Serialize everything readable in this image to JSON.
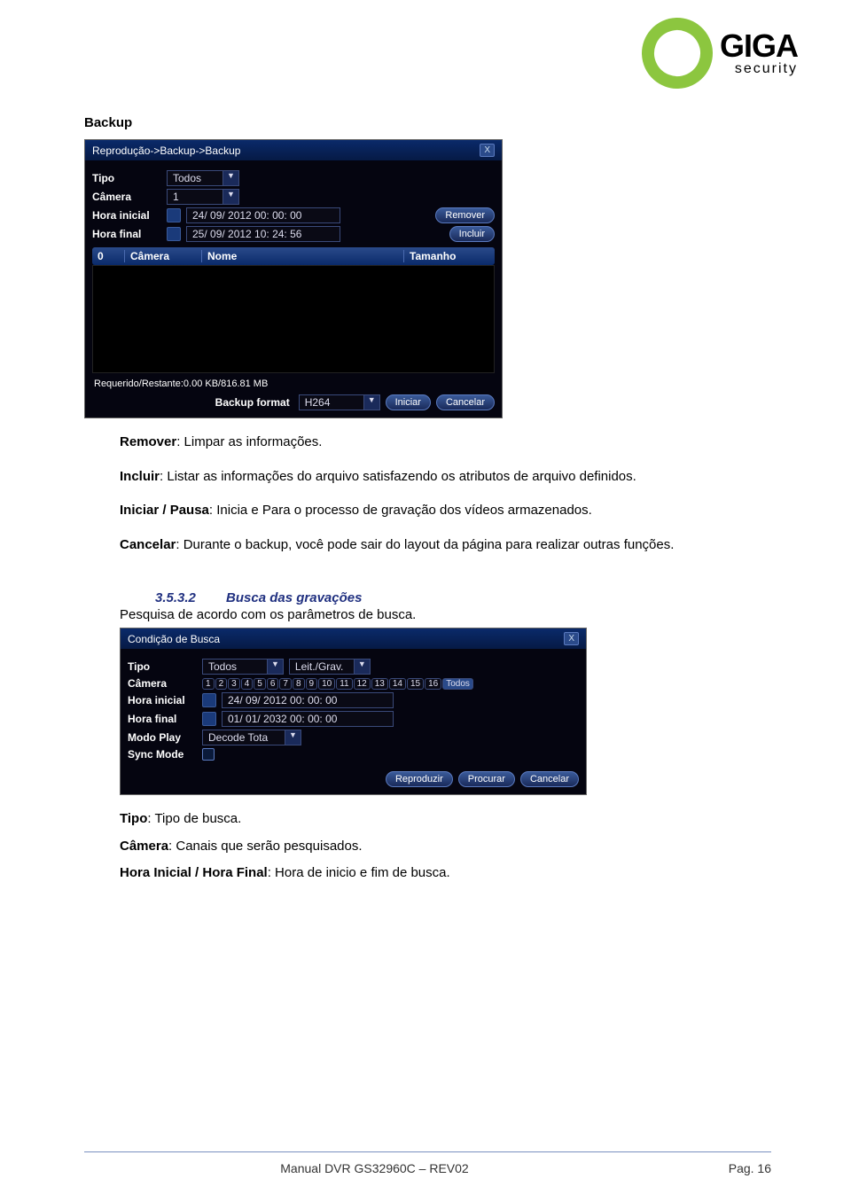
{
  "logo": {
    "brand": "GIGA",
    "sub": "security"
  },
  "section1": {
    "title": "Backup"
  },
  "backup_dialog": {
    "title": "Reprodução->Backup->Backup",
    "labels": {
      "tipo": "Tipo",
      "camera": "Câmera",
      "hora_inicial": "Hora inicial",
      "hora_final": "Hora final"
    },
    "values": {
      "tipo": "Todos",
      "camera": "1",
      "hora_inicial": "24/ 09/ 2012  00: 00: 00",
      "hora_final": "25/ 09/ 2012  10: 24: 56"
    },
    "buttons": {
      "remover": "Remover",
      "incluir": "Incluir"
    },
    "table": {
      "col0": "0",
      "col1": "Câmera",
      "col2": "Nome",
      "col3": "Tamanho"
    },
    "status": "Requerido/Restante:0.00 KB/816.81 MB",
    "footer": {
      "label": "Backup format",
      "format": "H264",
      "iniciar": "Iniciar",
      "cancelar": "Cancelar"
    }
  },
  "desc1": {
    "remover_b": "Remover",
    "remover_t": ": Limpar as informações.",
    "incluir_b": "Incluir",
    "incluir_t": ": Listar as informações do arquivo satisfazendo os atributos de arquivo definidos.",
    "iniciar_b": "Iniciar / Pausa",
    "iniciar_t": ": Inicia e Para o processo de gravação dos vídeos armazenados.",
    "cancelar_b": "Cancelar",
    "cancelar_t": ": Durante o backup, você pode sair do layout da página para realizar outras funções."
  },
  "section2": {
    "num": "3.5.3.2",
    "name": "Busca das gravações",
    "desc": "Pesquisa de acordo com os parâmetros de busca."
  },
  "busca_dialog": {
    "title": "Condição de Busca",
    "labels": {
      "tipo": "Tipo",
      "camera": "Câmera",
      "hora_inicial": "Hora inicial",
      "hora_final": "Hora final",
      "modo_play": "Modo Play",
      "sync_mode": "Sync Mode"
    },
    "values": {
      "tipo": "Todos",
      "leit": "Leit./Grav.",
      "hora_inicial": "24/ 09/ 2012  00: 00: 00",
      "hora_final": "01/ 01/ 2032  00: 00: 00",
      "modo_play": "Decode Tota"
    },
    "channels": [
      "1",
      "2",
      "3",
      "4",
      "5",
      "6",
      "7",
      "8",
      "9",
      "10",
      "11",
      "12",
      "13",
      "14",
      "15",
      "16",
      "Todos"
    ],
    "buttons": {
      "reproduzir": "Reproduzir",
      "procurar": "Procurar",
      "cancelar": "Cancelar"
    }
  },
  "desc2": {
    "tipo_b": "Tipo",
    "tipo_t": ": Tipo de busca.",
    "camera_b": "Câmera",
    "camera_t": ": Canais que serão pesquisados.",
    "hora_b": "Hora Inicial / Hora Final",
    "hora_t": ": Hora de inicio e fim de busca."
  },
  "footer": {
    "left": "Manual DVR GS32960C – REV02",
    "right": "Pag. 16"
  }
}
